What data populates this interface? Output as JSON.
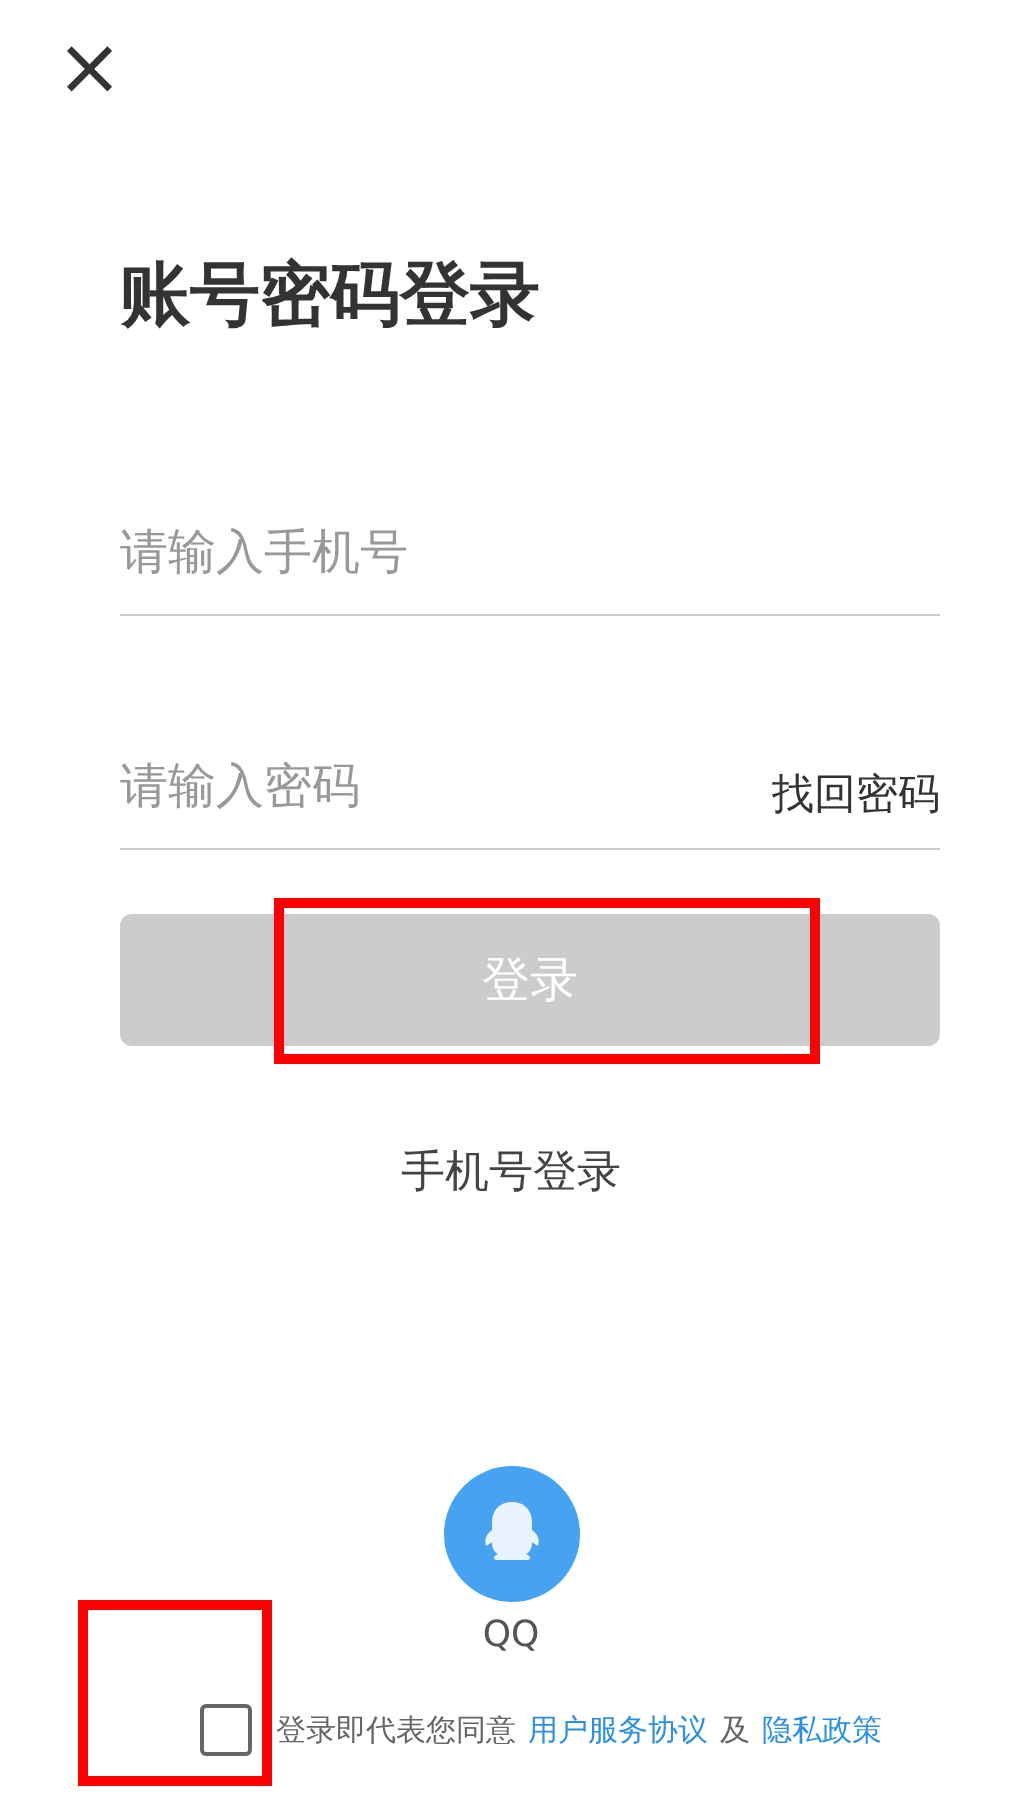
{
  "close_button": {
    "label": "×"
  },
  "title": "账号密码登录",
  "phone_field": {
    "placeholder": "请输入手机号"
  },
  "password_field": {
    "placeholder": "请输入密码",
    "link": "找回密码"
  },
  "login_button": {
    "label": "登录",
    "disabled": true,
    "highlighted": true
  },
  "alt_login_link": "手机号登录",
  "social_login": {
    "label": "QQ"
  },
  "agreement": {
    "checked": false,
    "highlighted": true,
    "text": "登录即代表您同意",
    "link_1": "用户服务协议",
    "joiner": "及",
    "link_2": "隐私政策"
  }
}
